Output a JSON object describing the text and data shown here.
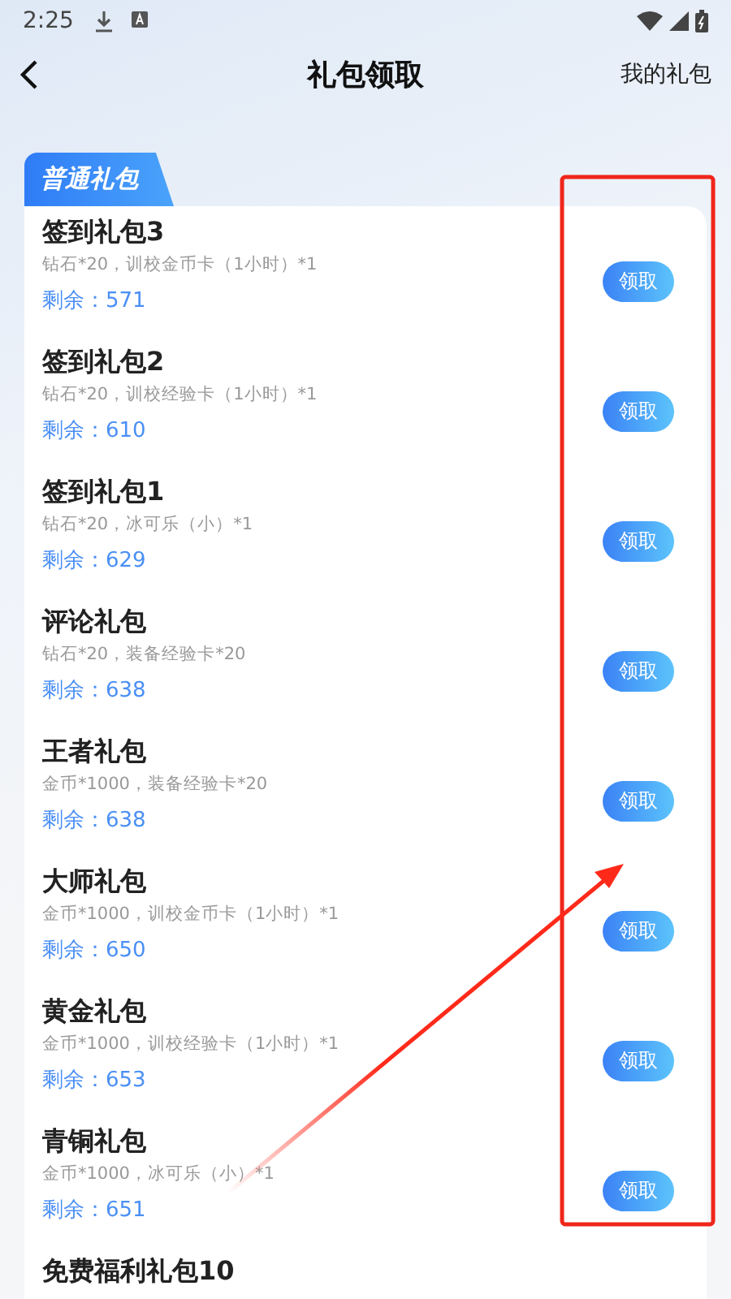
{
  "status_bar": {
    "time": "2:25"
  },
  "nav": {
    "title": "礼包领取",
    "action": "我的礼包"
  },
  "section_tab": {
    "label": "普通礼包"
  },
  "gifts": [
    {
      "title": "签到礼包3",
      "contents": "钻石*20，训校金币卡（1小时）*1",
      "remaining": "剩余：571",
      "button": "领取"
    },
    {
      "title": "签到礼包2",
      "contents": "钻石*20，训校经验卡（1小时）*1",
      "remaining": "剩余：610",
      "button": "领取"
    },
    {
      "title": "签到礼包1",
      "contents": "钻石*20，冰可乐（小）*1",
      "remaining": "剩余：629",
      "button": "领取"
    },
    {
      "title": "评论礼包",
      "contents": "钻石*20，装备经验卡*20",
      "remaining": "剩余：638",
      "button": "领取"
    },
    {
      "title": "王者礼包",
      "contents": "金币*1000，装备经验卡*20",
      "remaining": "剩余：638",
      "button": "领取"
    },
    {
      "title": "大师礼包",
      "contents": "金币*1000，训校金币卡（1小时）*1",
      "remaining": "剩余：650",
      "button": "领取"
    },
    {
      "title": "黄金礼包",
      "contents": "金币*1000，训校经验卡（1小时）*1",
      "remaining": "剩余：653",
      "button": "领取"
    },
    {
      "title": "青铜礼包",
      "contents": "金币*1000，冰可乐（小）*1",
      "remaining": "剩余：651",
      "button": "领取"
    },
    {
      "title": "免费福利礼包10"
    }
  ]
}
